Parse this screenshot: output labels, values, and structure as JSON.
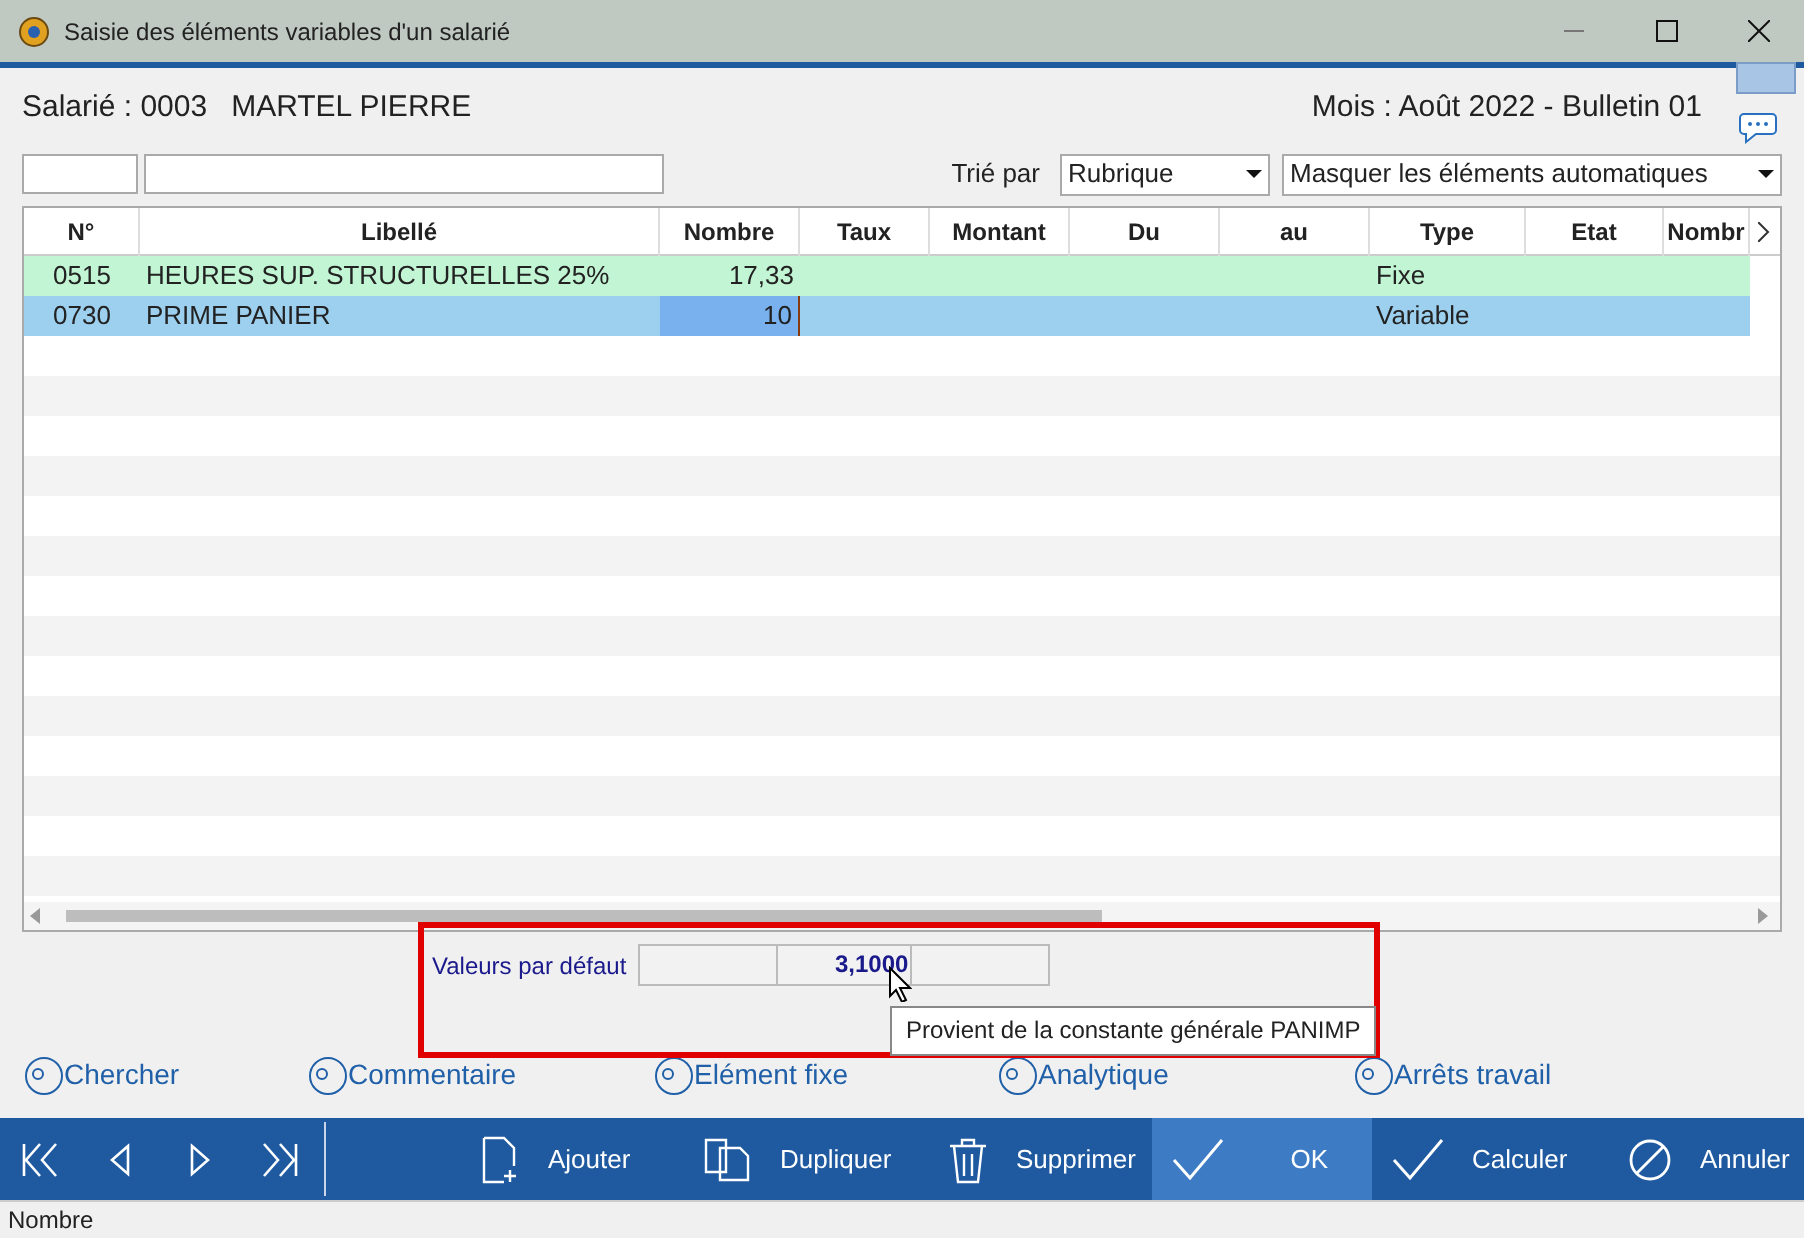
{
  "window": {
    "title": "Saisie des éléments variables d'un salarié"
  },
  "header": {
    "employee": "Salarié : 0003",
    "name": "MARTEL PIERRE",
    "period": "Mois : Août 2022 - Bulletin 01"
  },
  "filters": {
    "sort_label": "Trié par",
    "sort_value": "Rubrique",
    "mode_value": "Masquer les éléments automatiques"
  },
  "table": {
    "columns": [
      "N°",
      "Libellé",
      "Nombre",
      "Taux",
      "Montant",
      "Du",
      "au",
      "Type",
      "Etat",
      "Nombr"
    ],
    "rows": [
      {
        "cells": [
          "0515",
          "HEURES SUP. STRUCTURELLES 25%",
          "17,33",
          "",
          "",
          "",
          "",
          "Fixe",
          "",
          ""
        ],
        "selected": false,
        "color": "#c2f5d3"
      },
      {
        "cells": [
          "0730",
          "PRIME PANIER",
          "10",
          "",
          "",
          "",
          "",
          "Variable",
          "",
          ""
        ],
        "selected": true,
        "color": "#9dcfee"
      }
    ]
  },
  "defaults": {
    "label": "Valeurs par défaut",
    "value": "3,1000",
    "tooltip": "Provient de la constante générale PANIMP"
  },
  "links": [
    "Chercher",
    "Commentaire",
    "Elément fixe",
    "Analytique",
    "Arrêts travail"
  ],
  "toolbar": [
    {
      "label": "Ajouter",
      "kind": "add",
      "selected": false
    },
    {
      "label": "Dupliquer",
      "kind": "copy",
      "selected": false
    },
    {
      "label": "Supprimer",
      "kind": "delete",
      "selected": false
    },
    {
      "label": "OK",
      "kind": "check",
      "selected": true
    },
    {
      "label": "Calculer",
      "kind": "check",
      "selected": false
    },
    {
      "label": "Annuler",
      "kind": "cancel",
      "selected": false
    }
  ],
  "status_bar": "Nombre"
}
